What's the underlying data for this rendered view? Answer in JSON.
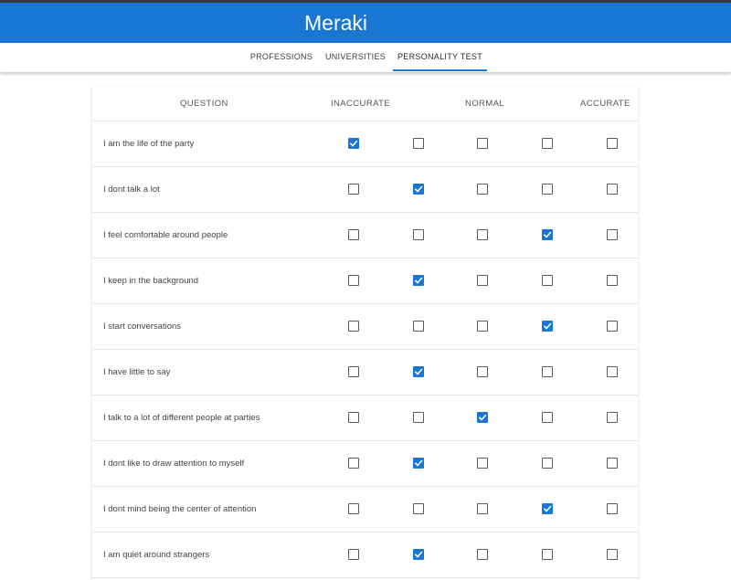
{
  "app": {
    "title": "Meraki"
  },
  "tabs": [
    {
      "label": "PROFESSIONS",
      "active": false
    },
    {
      "label": "UNIVERSITIES",
      "active": false
    },
    {
      "label": "PERSONALITY TEST",
      "active": true
    }
  ],
  "table": {
    "headers": {
      "question": "QUESTION",
      "inaccurate": "INACCURATE",
      "normal": "NORMAL",
      "accurate": "ACCURATE"
    },
    "rows": [
      {
        "question": "I am the life of the party",
        "selected": 1
      },
      {
        "question": "I dont talk a lot",
        "selected": 2
      },
      {
        "question": "I feel comfortable around people",
        "selected": 4
      },
      {
        "question": "I keep in the background",
        "selected": 2
      },
      {
        "question": "I start conversations",
        "selected": 4
      },
      {
        "question": "I have little to say",
        "selected": 2
      },
      {
        "question": "I talk to a lot of different people at parties",
        "selected": 3
      },
      {
        "question": "I dont like to draw attention to myself",
        "selected": 2
      },
      {
        "question": "I dont mind being the center of attention",
        "selected": 4
      },
      {
        "question": "I am quiet around strangers",
        "selected": 2
      }
    ]
  },
  "colors": {
    "primary": "#1976d2",
    "checkbox_border": "#5a5a5a"
  },
  "icons": {
    "checkmark": "check-icon"
  }
}
